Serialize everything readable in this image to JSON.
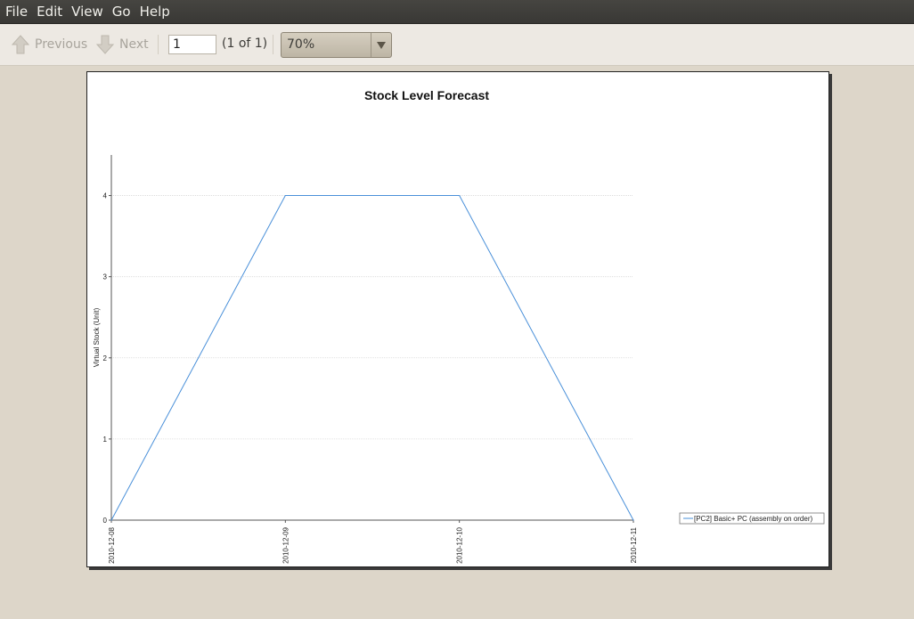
{
  "menubar": {
    "items": [
      {
        "label": "File"
      },
      {
        "label": "Edit"
      },
      {
        "label": "View"
      },
      {
        "label": "Go"
      },
      {
        "label": "Help"
      }
    ]
  },
  "toolbar": {
    "previous_label": "Previous",
    "next_label": "Next",
    "page_value": "1",
    "page_count": "(1 of 1)",
    "zoom_value": "70%"
  },
  "colors": {
    "menubar_bg": "#3c3b37",
    "toolbar_bg": "#ede9e3",
    "doc_bg": "#ddd6c9",
    "series": "#4a90d9"
  },
  "icons": {
    "previous": "arrow-up-icon",
    "next": "arrow-down-icon",
    "zoom_dropdown": "triangle-down-icon"
  },
  "chart_data": {
    "type": "line",
    "title": "Stock Level Forecast",
    "xlabel": "",
    "ylabel": "Virtual Stock (Unit)",
    "x": [
      "2010-12-08",
      "2010-12-09",
      "2010-12-10",
      "2010-12-11"
    ],
    "series": [
      {
        "name": "[PC2] Basic+ PC (assembly on order)",
        "values": [
          0,
          4,
          4,
          0
        ]
      }
    ],
    "ylim": [
      0,
      4.5
    ],
    "yticks": [
      0,
      1,
      2,
      3,
      4
    ],
    "grid": true,
    "legend": "right"
  }
}
